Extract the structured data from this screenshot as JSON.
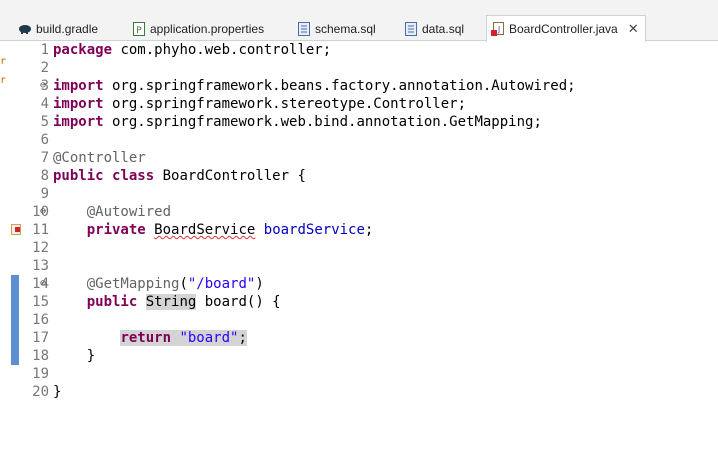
{
  "tabs": [
    {
      "label": "build.gradle",
      "icon": "gradle-elephant-icon",
      "active": false
    },
    {
      "label": "application.properties",
      "icon": "properties-file-icon",
      "active": false
    },
    {
      "label": "schema.sql",
      "icon": "sql-file-icon",
      "active": false
    },
    {
      "label": "data.sql",
      "icon": "sql-file-icon",
      "active": false
    },
    {
      "label": "BoardController.java",
      "icon": "java-file-error-icon",
      "active": true
    }
  ],
  "tab_close_glyph": "✕",
  "left_strip_marks": [
    "r",
    "r"
  ],
  "fold_glyph": "⊖",
  "lines": [
    {
      "n": "1",
      "text": "package com.phyho.web.controller;"
    },
    {
      "n": "2",
      "text": ""
    },
    {
      "n": "3",
      "text": "import org.springframework.beans.factory.annotation.Autowired;"
    },
    {
      "n": "4",
      "text": "import org.springframework.stereotype.Controller;"
    },
    {
      "n": "5",
      "text": "import org.springframework.web.bind.annotation.GetMapping;"
    },
    {
      "n": "6",
      "text": ""
    },
    {
      "n": "7",
      "text": "@Controller"
    },
    {
      "n": "8",
      "text": "public class BoardController {"
    },
    {
      "n": "9",
      "text": ""
    },
    {
      "n": "10",
      "text": "    @Autowired"
    },
    {
      "n": "11",
      "text": "    private BoardService boardService;"
    },
    {
      "n": "12",
      "text": ""
    },
    {
      "n": "13",
      "text": ""
    },
    {
      "n": "14",
      "text": "    @GetMapping(\"/board\")"
    },
    {
      "n": "15",
      "text": "    public String board() {"
    },
    {
      "n": "16",
      "text": ""
    },
    {
      "n": "17",
      "text": "        return \"board\";"
    },
    {
      "n": "18",
      "text": "    }"
    },
    {
      "n": "19",
      "text": ""
    },
    {
      "n": "20",
      "text": "}"
    }
  ],
  "tokens": {
    "kw_package": "package",
    "pkg_name": " com.phyho.web.controller;",
    "kw_import": "import",
    "imp1": " org.springframework.beans.factory.annotation.Autowired;",
    "imp2": " org.springframework.stereotype.Controller;",
    "imp3": " org.springframework.web.bind.annotation.GetMapping;",
    "ann_controller": "@Controller",
    "kw_public": "public",
    "kw_class": "class",
    "class_name": " BoardController {",
    "ann_autowired": "@Autowired",
    "kw_private": "private",
    "type_boardservice": "BoardService",
    "field_boardservice": "boardService",
    "semicolon": ";",
    "ann_getmapping": "@GetMapping",
    "paren_open": "(",
    "str_board_path": "\"/board\"",
    "paren_close": ")",
    "type_string": "String",
    "method_sig": " board() {",
    "kw_return": "return",
    "str_board": "\"board\"",
    "brace_close": "}"
  },
  "colors": {
    "keyword": "#7f0055",
    "annotation": "#646464",
    "string": "#2a00ff",
    "field": "#0000c0",
    "line_number": "#787878",
    "change_bar": "#5b8fd1"
  }
}
